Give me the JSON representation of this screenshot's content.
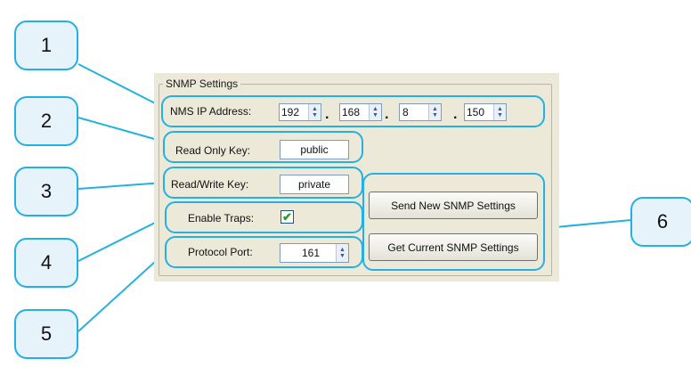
{
  "callouts": [
    "1",
    "2",
    "3",
    "4",
    "5",
    "6"
  ],
  "group_title": "SNMP Settings",
  "nms": {
    "label": "NMS IP Address:",
    "octets": [
      "192",
      "168",
      "8",
      "150"
    ],
    "separator": "."
  },
  "read_only": {
    "label": "Read Only Key:",
    "value": "public"
  },
  "read_write": {
    "label": "Read/Write Key:",
    "value": "private"
  },
  "traps": {
    "label": "Enable Traps:",
    "checked": true,
    "check_glyph": "✔"
  },
  "port": {
    "label": "Protocol Port:",
    "value": "161"
  },
  "buttons": {
    "send": "Send New SNMP Settings",
    "get": "Get Current SNMP Settings"
  },
  "colors": {
    "highlight": "#24b0e3",
    "panel": "#ece9d8",
    "callout_fill": "#e6f3fa"
  },
  "icons": {
    "spin": "spinner-arrows-icon",
    "check": "checkmark-icon"
  }
}
